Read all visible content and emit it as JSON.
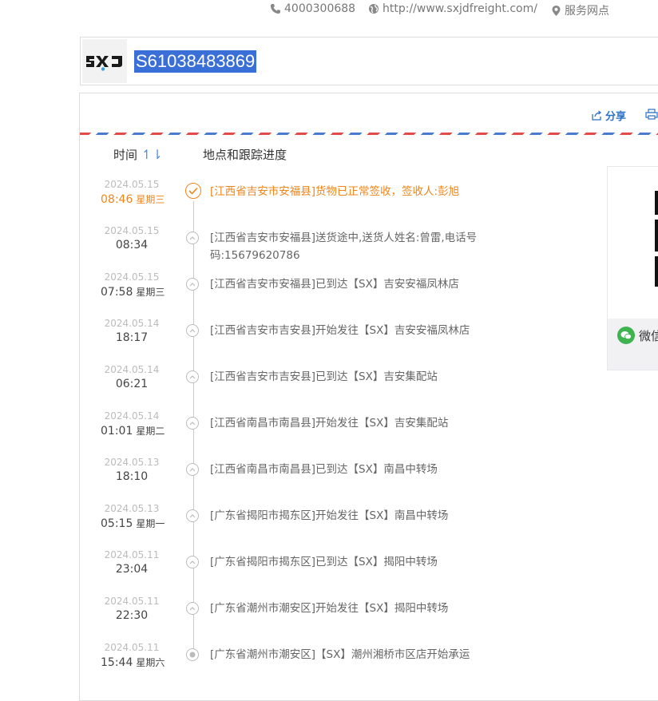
{
  "topbar": {
    "phone": "4000300688",
    "website": "http://www.sxjdfreight.com/",
    "outlets": "服务网点"
  },
  "header": {
    "logo_text": "SXJ",
    "tracking_number": "S61038483869"
  },
  "card": {
    "share_label": "分享",
    "col_time": "时间",
    "col_location": "地点和跟踪进度",
    "wechat_label": "微信"
  },
  "events": [
    {
      "date": "2024.05.15",
      "time": "08:46",
      "weekday": "星期三",
      "desc": "[江西省吉安市安福县]货物已正常签收，签收人:彭旭",
      "status": "delivered"
    },
    {
      "date": "2024.05.15",
      "time": "08:34",
      "weekday": "",
      "desc": "[江西省吉安市安福县]送货途中,送货人姓名:曾雷,电话号码:15679620786",
      "status": "transit"
    },
    {
      "date": "2024.05.15",
      "time": "07:58",
      "weekday": "星期三",
      "desc": "[江西省吉安市安福县]已到达【SX】吉安安福凤林店",
      "status": "transit"
    },
    {
      "date": "2024.05.14",
      "time": "18:17",
      "weekday": "",
      "desc": "[江西省吉安市吉安县]开始发往【SX】吉安安福凤林店",
      "status": "transit"
    },
    {
      "date": "2024.05.14",
      "time": "06:21",
      "weekday": "",
      "desc": "[江西省吉安市吉安县]已到达【SX】吉安集配站",
      "status": "transit"
    },
    {
      "date": "2024.05.14",
      "time": "01:01",
      "weekday": "星期二",
      "desc": "[江西省南昌市南昌县]开始发往【SX】吉安集配站",
      "status": "transit"
    },
    {
      "date": "2024.05.13",
      "time": "18:10",
      "weekday": "",
      "desc": "[江西省南昌市南昌县]已到达【SX】南昌中转场",
      "status": "transit"
    },
    {
      "date": "2024.05.13",
      "time": "05:15",
      "weekday": "星期一",
      "desc": "[广东省揭阳市揭东区]开始发往【SX】南昌中转场",
      "status": "transit"
    },
    {
      "date": "2024.05.11",
      "time": "23:04",
      "weekday": "",
      "desc": "[广东省揭阳市揭东区]已到达【SX】揭阳中转场",
      "status": "transit"
    },
    {
      "date": "2024.05.11",
      "time": "22:30",
      "weekday": "",
      "desc": "[广东省潮州市潮安区]开始发往【SX】揭阳中转场",
      "status": "transit"
    },
    {
      "date": "2024.05.11",
      "time": "15:44",
      "weekday": "星期六",
      "desc": "[广东省潮州市潮安区]【SX】潮州湘桥市区店开始承运",
      "status": "origin"
    }
  ],
  "colors": {
    "accent_orange": "#f08519",
    "link_blue": "#2c72c7",
    "selection_blue": "#3a6fd8",
    "wechat_green": "#3fb34f"
  }
}
